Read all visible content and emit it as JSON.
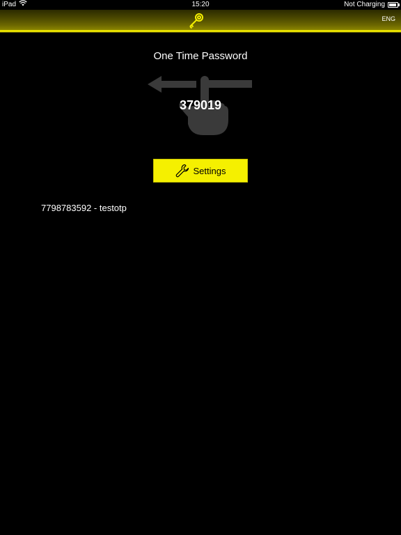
{
  "status_bar": {
    "device": "iPad",
    "time": "15:20",
    "charging": "Not Charging",
    "icons": [
      "wifi-icon",
      "battery-icon"
    ]
  },
  "header": {
    "logo_icon": "key-icon",
    "language": "ENG",
    "accent_color": "#f5f000"
  },
  "main": {
    "title": "One Time Password",
    "otp_code": "379019",
    "swipe_hint_icon": "swipe-left-hand-icon",
    "settings_button": {
      "label": "Settings",
      "icon": "wrench-icon"
    },
    "account": "7798783592 - testotp"
  }
}
